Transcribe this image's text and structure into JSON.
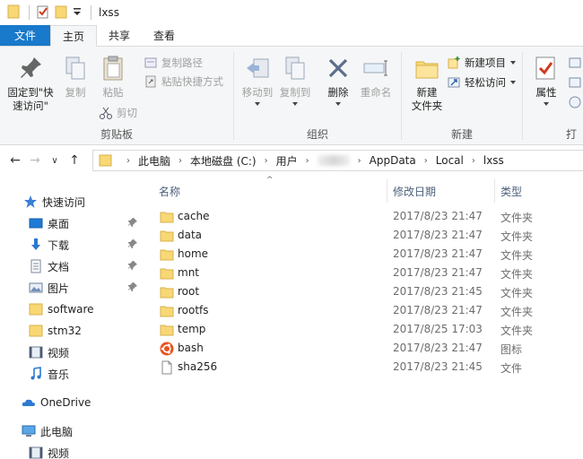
{
  "window": {
    "title": "lxss"
  },
  "tabs": [
    {
      "label": "文件"
    },
    {
      "label": "主页"
    },
    {
      "label": "共享"
    },
    {
      "label": "查看"
    }
  ],
  "ribbon": {
    "clipboard": {
      "label": "剪贴板",
      "pin": "固定到\"快\n速访问\"",
      "pin_line1": "固定到\"快",
      "pin_line2": "速访问\"",
      "copy": "复制",
      "paste": "粘贴",
      "copy_path": "复制路径",
      "paste_shortcut": "粘贴快捷方式",
      "cut": "剪切"
    },
    "organize": {
      "label": "组织",
      "move_to": "移动到",
      "copy_to": "复制到",
      "delete": "删除",
      "rename": "重命名"
    },
    "new": {
      "label": "新建",
      "new_folder_line1": "新建",
      "new_folder_line2": "文件夹",
      "new_item": "新建项目",
      "easy_access": "轻松访问"
    },
    "open": {
      "label": "打",
      "properties": "属性"
    }
  },
  "address": {
    "crumbs": [
      "此电脑",
      "本地磁盘 (C:)",
      "用户",
      "AppData",
      "Local",
      "lxss"
    ]
  },
  "navpane": {
    "quick_access": "快速访问",
    "items": [
      {
        "label": "桌面",
        "icon": "desktop-icon",
        "pinned": true
      },
      {
        "label": "下载",
        "icon": "download-icon",
        "pinned": true
      },
      {
        "label": "文档",
        "icon": "document-icon",
        "pinned": true
      },
      {
        "label": "图片",
        "icon": "picture-icon",
        "pinned": true
      },
      {
        "label": "software",
        "icon": "folder-icon",
        "pinned": false
      },
      {
        "label": "stm32",
        "icon": "folder-icon",
        "pinned": false
      },
      {
        "label": "视频",
        "icon": "video-icon",
        "pinned": false
      },
      {
        "label": "音乐",
        "icon": "music-icon",
        "pinned": false
      }
    ],
    "onedrive": "OneDrive",
    "this_pc": "此电脑",
    "this_pc_video": "视频"
  },
  "filelist": {
    "columns": {
      "name": "名称",
      "date": "修改日期",
      "type": "类型"
    },
    "files": [
      {
        "name": "cache",
        "date": "2017/8/23 21:47",
        "type": "文件夹",
        "icon": "folder-icon"
      },
      {
        "name": "data",
        "date": "2017/8/23 21:47",
        "type": "文件夹",
        "icon": "folder-icon"
      },
      {
        "name": "home",
        "date": "2017/8/23 21:47",
        "type": "文件夹",
        "icon": "folder-icon"
      },
      {
        "name": "mnt",
        "date": "2017/8/23 21:47",
        "type": "文件夹",
        "icon": "folder-icon"
      },
      {
        "name": "root",
        "date": "2017/8/23 21:45",
        "type": "文件夹",
        "icon": "folder-icon"
      },
      {
        "name": "rootfs",
        "date": "2017/8/23 21:47",
        "type": "文件夹",
        "icon": "folder-icon"
      },
      {
        "name": "temp",
        "date": "2017/8/25 17:03",
        "type": "文件夹",
        "icon": "folder-icon"
      },
      {
        "name": "bash",
        "date": "2017/8/23 21:47",
        "type": "图标",
        "icon": "ubuntu-icon"
      },
      {
        "name": "sha256",
        "date": "2017/8/23 21:45",
        "type": "文件",
        "icon": "file-icon"
      }
    ]
  },
  "colors": {
    "accent": "#1979ca",
    "folder": "#f8d775",
    "ribbon_bg": "#f5f6f7",
    "header_text": "#4c607a"
  }
}
